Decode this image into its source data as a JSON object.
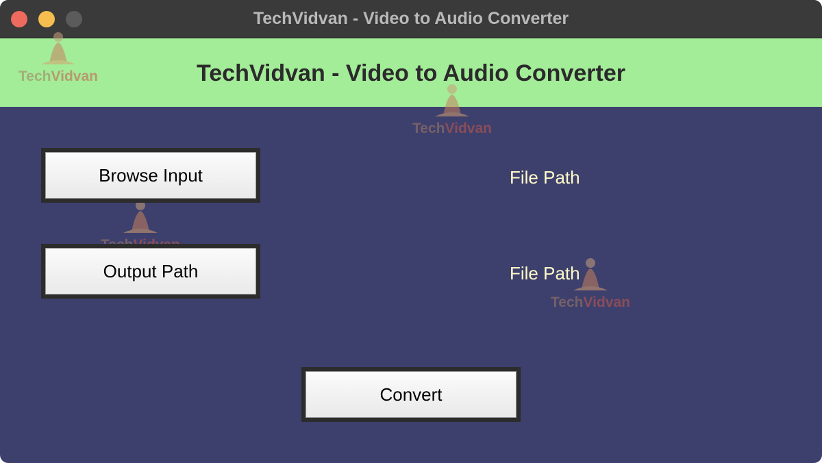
{
  "window": {
    "title": "TechVidvan - Video to Audio Converter"
  },
  "header": {
    "title": "TechVidvan - Video to Audio Converter"
  },
  "watermark": {
    "brand_a": "Tech",
    "brand_b": "Vidvan"
  },
  "input_row": {
    "button_label": "Browse Input",
    "path_label": "File Path"
  },
  "output_row": {
    "button_label": "Output Path",
    "path_label": "File Path"
  },
  "actions": {
    "convert_label": "Convert"
  },
  "colors": {
    "body_background": "#3d406d",
    "header_background": "#a3ec98",
    "path_text": "#fffac8",
    "titlebar": "#3a3a3a"
  },
  "icons": {
    "close": "close-circle-icon",
    "minimize": "minimize-circle-icon",
    "zoom": "zoom-circle-icon",
    "watermark": "techvidvan-logo-icon"
  }
}
